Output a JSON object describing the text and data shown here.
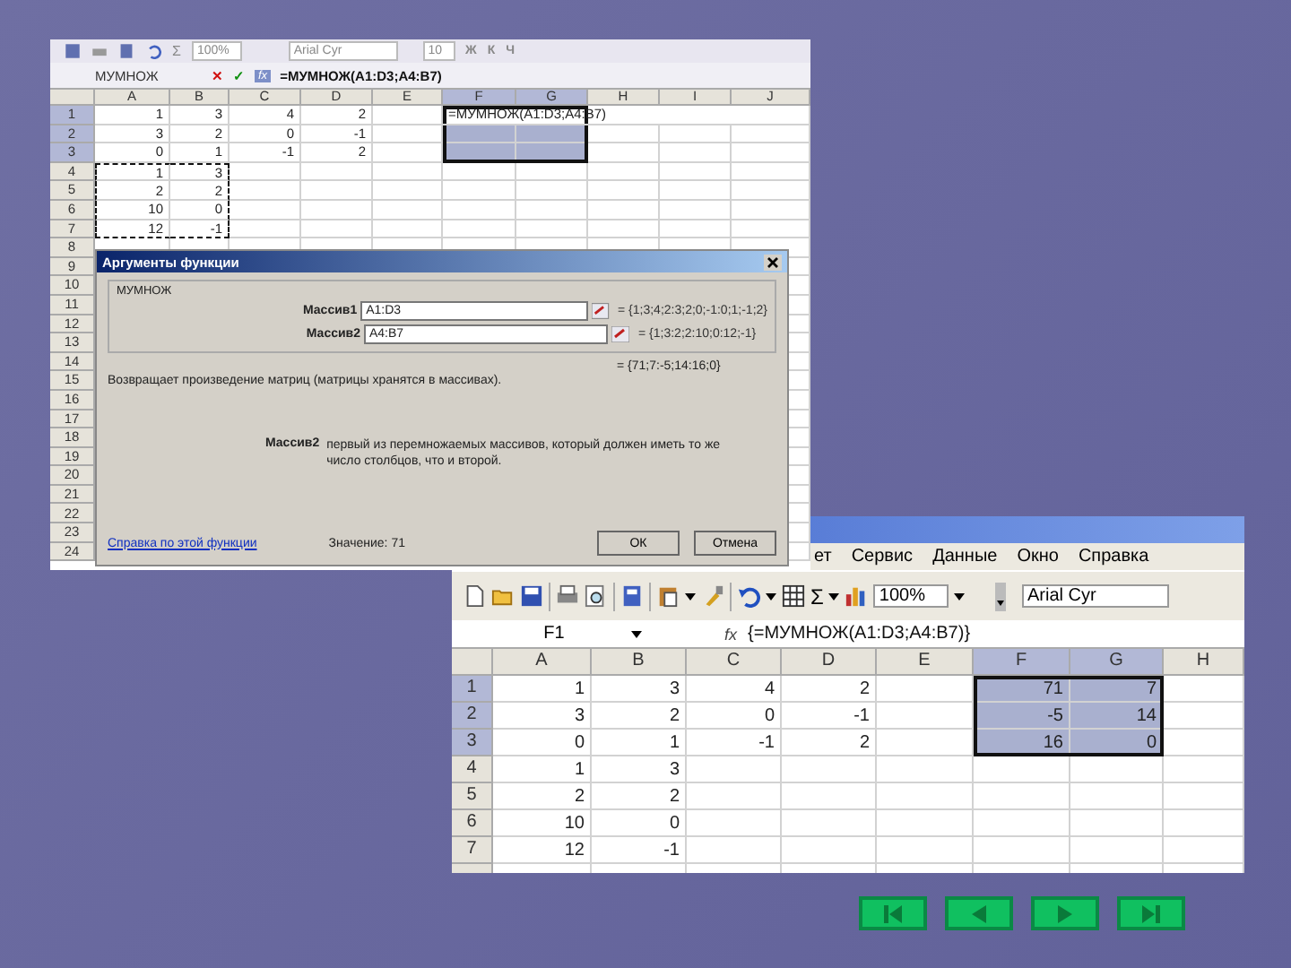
{
  "back_window": {
    "toolbar": {
      "sum": "Σ",
      "zoom": "100%",
      "font": "Arial Cyr",
      "size": "10",
      "format_buttons": [
        "Ж",
        "К",
        "Ч"
      ]
    },
    "formula_bar": {
      "name_box": "МУМНОЖ",
      "cancel": "✕",
      "enter": "✓",
      "function_button": "fx",
      "formula": "=МУМНОЖ(A1:D3;A4:B7)"
    },
    "sheet": {
      "active_cell_text": "=МУМНОЖ(A1:D3;A4:B7)",
      "columns": [
        {
          "label": "A",
          "selected": false
        },
        {
          "label": "B",
          "selected": false
        },
        {
          "label": "C",
          "selected": false
        },
        {
          "label": "D",
          "selected": false
        },
        {
          "label": "E",
          "selected": false
        },
        {
          "label": "F",
          "selected": true
        },
        {
          "label": "G",
          "selected": true
        },
        {
          "label": "H",
          "selected": false
        },
        {
          "label": "I",
          "selected": false
        },
        {
          "label": "J",
          "selected": false
        }
      ],
      "rows": [
        {
          "header": "1",
          "selected": true,
          "cells": [
            "1",
            "3",
            "4",
            "2"
          ]
        },
        {
          "header": "2",
          "selected": true,
          "cells": [
            "3",
            "2",
            "0",
            "-1"
          ]
        },
        {
          "header": "3",
          "selected": true,
          "cells": [
            "0",
            "1",
            "-1",
            "2"
          ]
        },
        {
          "header": "4",
          "selected": false,
          "cells": [
            {
              "text": "1",
              "copied": true
            },
            {
              "text": "3",
              "copied": true
            }
          ]
        },
        {
          "header": "5",
          "selected": false,
          "cells": [
            {
              "text": "2",
              "copied": true
            },
            {
              "text": "2",
              "copied": true
            }
          ]
        },
        {
          "header": "6",
          "selected": false,
          "cells": [
            {
              "text": "10",
              "copied": true
            },
            {
              "text": "0",
              "copied": true
            }
          ]
        },
        {
          "header": "7",
          "selected": false,
          "cells": [
            {
              "text": "12",
              "copied": true
            },
            {
              "text": "-1",
              "copied": true
            }
          ]
        },
        {
          "header": "8",
          "selected": false
        },
        {
          "header": "9",
          "selected": false
        },
        {
          "header": "10",
          "selected": false
        },
        {
          "header": "11",
          "selected": false
        },
        {
          "header": "12",
          "selected": false
        },
        {
          "header": "13",
          "selected": false
        },
        {
          "header": "14",
          "selected": false
        },
        {
          "header": "15",
          "selected": false
        },
        {
          "header": "16",
          "selected": false
        },
        {
          "header": "17",
          "selected": false
        },
        {
          "header": "18",
          "selected": false
        },
        {
          "header": "19",
          "selected": false
        },
        {
          "header": "20",
          "selected": false
        },
        {
          "header": "21",
          "selected": false
        },
        {
          "header": "22",
          "selected": false
        },
        {
          "header": "23",
          "selected": false
        },
        {
          "header": "24",
          "selected": false
        }
      ]
    },
    "dialog": {
      "title": "Аргументы функции",
      "function": "МУМНОЖ",
      "args": [
        {
          "label": "Массив1",
          "value": "A1:D3",
          "result": "= {1;3;4;2:3;2;0;-1:0;1;-1;2}"
        },
        {
          "label": "Массив2",
          "value": "A4:B7",
          "result": "= {1;3:2;2:10;0:12;-1}"
        }
      ],
      "result": "= {71;7:-5;14:16;0}",
      "description": "Возвращает произведение матриц (матрицы хранятся в массивах).",
      "arg_help_label": "Массив2",
      "arg_help": "первый из перемножаемых массивов, который должен иметь то же число столбцов, что и второй.",
      "help_link": "Справка по этой функции",
      "value": "Значение: 71",
      "buttons": [
        "ОК",
        "Отмена"
      ]
    }
  },
  "front_window": {
    "menu": [
      "ет",
      "Сервис",
      "Данные",
      "Окно",
      "Справка"
    ],
    "toolbar": {
      "sum": "Σ",
      "zoom": "100%",
      "font": "Arial Cyr"
    },
    "formula_bar": {
      "name_box": "F1",
      "function_button": "fx",
      "formula": "{=МУМНОЖ(A1:D3;A4:B7)}"
    },
    "sheet": {
      "columns": [
        {
          "label": "A",
          "selected": false
        },
        {
          "label": "B",
          "selected": false
        },
        {
          "label": "C",
          "selected": false
        },
        {
          "label": "D",
          "selected": false
        },
        {
          "label": "E",
          "selected": false
        },
        {
          "label": "F",
          "selected": true
        },
        {
          "label": "G",
          "selected": true
        },
        {
          "label": "H",
          "selected": false
        }
      ],
      "rows": [
        {
          "header": "1",
          "selected": true,
          "cells": [
            "1",
            "3",
            "4",
            "2"
          ],
          "selection_values": [
            "71",
            "7"
          ]
        },
        {
          "header": "2",
          "selected": true,
          "cells": [
            "3",
            "2",
            "0",
            "-1"
          ],
          "selection_values": [
            "-5",
            "14"
          ]
        },
        {
          "header": "3",
          "selected": true,
          "cells": [
            "0",
            "1",
            "-1",
            "2"
          ],
          "selection_values": [
            "16",
            "0"
          ]
        },
        {
          "header": "4",
          "selected": false,
          "cells": [
            "1",
            "3"
          ]
        },
        {
          "header": "5",
          "selected": false,
          "cells": [
            "2",
            "2"
          ]
        },
        {
          "header": "6",
          "selected": false,
          "cells": [
            "10",
            "0"
          ]
        },
        {
          "header": "7",
          "selected": false,
          "cells": [
            "12",
            "-1"
          ]
        }
      ]
    }
  },
  "nav_buttons": [
    {
      "kind": "first"
    },
    {
      "kind": "previous"
    },
    {
      "kind": "next"
    },
    {
      "kind": "last"
    }
  ]
}
